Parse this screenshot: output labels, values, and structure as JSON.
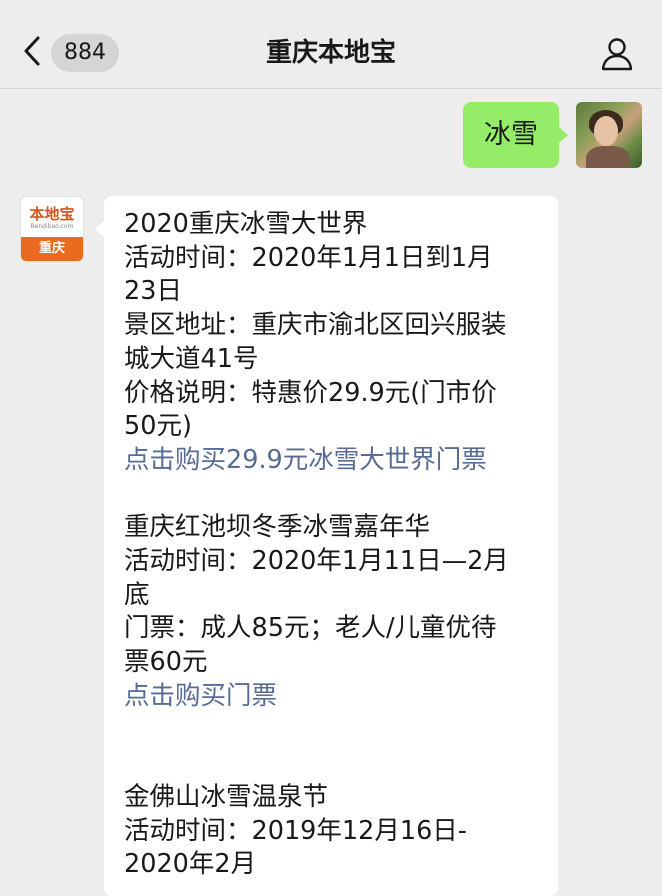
{
  "header": {
    "back_icon": "chevron-left-icon",
    "unread_count": "884",
    "title": "重庆本地宝",
    "profile_icon": "person-icon"
  },
  "messages": {
    "outgoing": {
      "text": "冰雪"
    },
    "sender": {
      "logo_text": "本地宝",
      "logo_url": "Bendibao.com",
      "city": "重庆"
    },
    "incoming": {
      "sections": [
        {
          "lines": [
            "2020重庆冰雪大世界",
            "活动时间：2020年1月1日到1月",
            "23日",
            "景区地址：重庆市渝北区回兴服装",
            "城大道41号",
            "价格说明：特惠价29.9元(门市价",
            "50元)"
          ],
          "link": "点击购买29.9元冰雪大世界门票"
        },
        {
          "lines": [
            "重庆红池坝冬季冰雪嘉年华",
            "活动时间：2020年1月11日—2月",
            "底",
            "门票：成人85元；老人/儿童优待",
            "票60元"
          ],
          "link": "点击购买门票"
        },
        {
          "lines": [
            "金佛山冰雪温泉节",
            "活动时间：2019年12月16日-",
            "2020年2月"
          ]
        }
      ]
    }
  },
  "colors": {
    "background": "#ededed",
    "outgoing_bubble": "#95ec69",
    "incoming_bubble": "#ffffff",
    "link": "#576b95",
    "brand_orange": "#ea6a1f"
  }
}
